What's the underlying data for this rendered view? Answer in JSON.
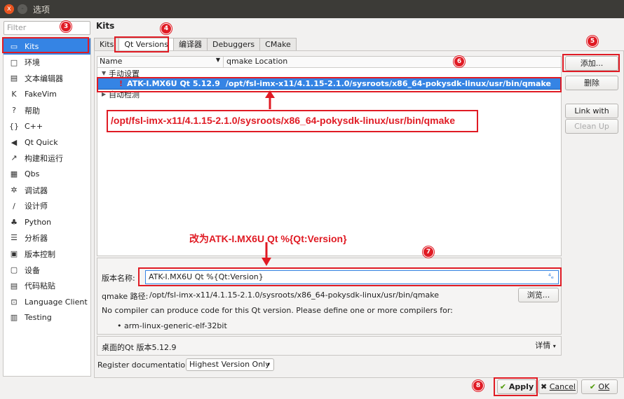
{
  "window": {
    "title": "选项",
    "close_glyph": "x",
    "min_glyph": "-"
  },
  "filter": {
    "placeholder": "Filter"
  },
  "sidebar": {
    "items": [
      {
        "icon": "kits-icon",
        "glyph": "▭",
        "label": "Kits",
        "selected": true
      },
      {
        "icon": "monitor-icon",
        "glyph": "□",
        "label": "环境"
      },
      {
        "icon": "text-editor-icon",
        "glyph": "▤",
        "label": "文本编辑器"
      },
      {
        "icon": "fakevim-icon",
        "glyph": "K",
        "label": "FakeVim"
      },
      {
        "icon": "help-icon",
        "glyph": "?",
        "label": "帮助"
      },
      {
        "icon": "braces-icon",
        "glyph": "{}",
        "label": "C++"
      },
      {
        "icon": "qtquick-icon",
        "glyph": "◀",
        "label": "Qt Quick"
      },
      {
        "icon": "build-run-icon",
        "glyph": "↗",
        "label": "构建和运行"
      },
      {
        "icon": "qbs-icon",
        "glyph": "▦",
        "label": "Qbs"
      },
      {
        "icon": "bug-icon",
        "glyph": "✲",
        "label": "调试器"
      },
      {
        "icon": "pen-icon",
        "glyph": "/",
        "label": "设计师"
      },
      {
        "icon": "python-icon",
        "glyph": "♣",
        "label": "Python"
      },
      {
        "icon": "analyzer-icon",
        "glyph": "☰",
        "label": "分析器"
      },
      {
        "icon": "version-control-icon",
        "glyph": "▣",
        "label": "版本控制"
      },
      {
        "icon": "device-icon",
        "glyph": "▢",
        "label": "设备"
      },
      {
        "icon": "paste-icon",
        "glyph": "▤",
        "label": "代码粘贴"
      },
      {
        "icon": "language-client-icon",
        "glyph": "⊡",
        "label": "Language Client"
      },
      {
        "icon": "testing-icon",
        "glyph": "▥",
        "label": "Testing"
      }
    ]
  },
  "page_title": "Kits",
  "tabs": [
    {
      "label": "Kits"
    },
    {
      "label": "Qt Versions",
      "selected": true
    },
    {
      "label": "编译器"
    },
    {
      "label": "Debuggers"
    },
    {
      "label": "CMake"
    }
  ],
  "tree": {
    "col_name": "Name",
    "col_location": "qmake Location",
    "manual_group": "手动设置",
    "auto_group": "自动检测",
    "selected_row": {
      "warning_glyph": "!",
      "name": "ATK-I.MX6U Qt 5.12.9",
      "location": "/opt/fsl-imx-x11/4.1.15-2.1.0/sysroots/x86_64-pokysdk-linux/usr/bin/qmake"
    }
  },
  "side_buttons": {
    "add": "添加...",
    "remove": "删除",
    "link": "Link with Qt...",
    "cleanup": "Clean Up"
  },
  "details": {
    "version_name_label": "版本名称:",
    "version_name_value": "ATK-I.MX6U Qt %{Qt:Version}",
    "clear_glyph": "⁴ₑ",
    "qmake_path_label": "qmake 路径:",
    "qmake_path_value": "/opt/fsl-imx-x11/4.1.15-2.1.0/sysroots/x86_64-pokysdk-linux/usr/bin/qmake",
    "browse": "浏览...",
    "no_compiler_msg": "No compiler can produce code for this Qt version. Please define one or more compilers for:",
    "abi_item": "• arm-linux-generic-elf-32bit"
  },
  "summary": {
    "text": "桌面的Qt 版本5.12.9",
    "details_button": "详情"
  },
  "register_doc": {
    "label": "Register documentation:",
    "value": "Highest Version Only"
  },
  "footer": {
    "apply": "Apply",
    "cancel": "Cancel",
    "ok": "OK"
  },
  "annotations": {
    "badges": [
      "3",
      "4",
      "5",
      "6",
      "7",
      "8"
    ],
    "path_note": "/opt/fsl-imx-x11/4.1.15-2.1.0/sysroots/x86_64-pokysdk-linux/usr/bin/qmake",
    "rename_note": "改为ATK-I.MX6U Qt %{Qt:Version}",
    "accent_color": "#e01b24"
  }
}
